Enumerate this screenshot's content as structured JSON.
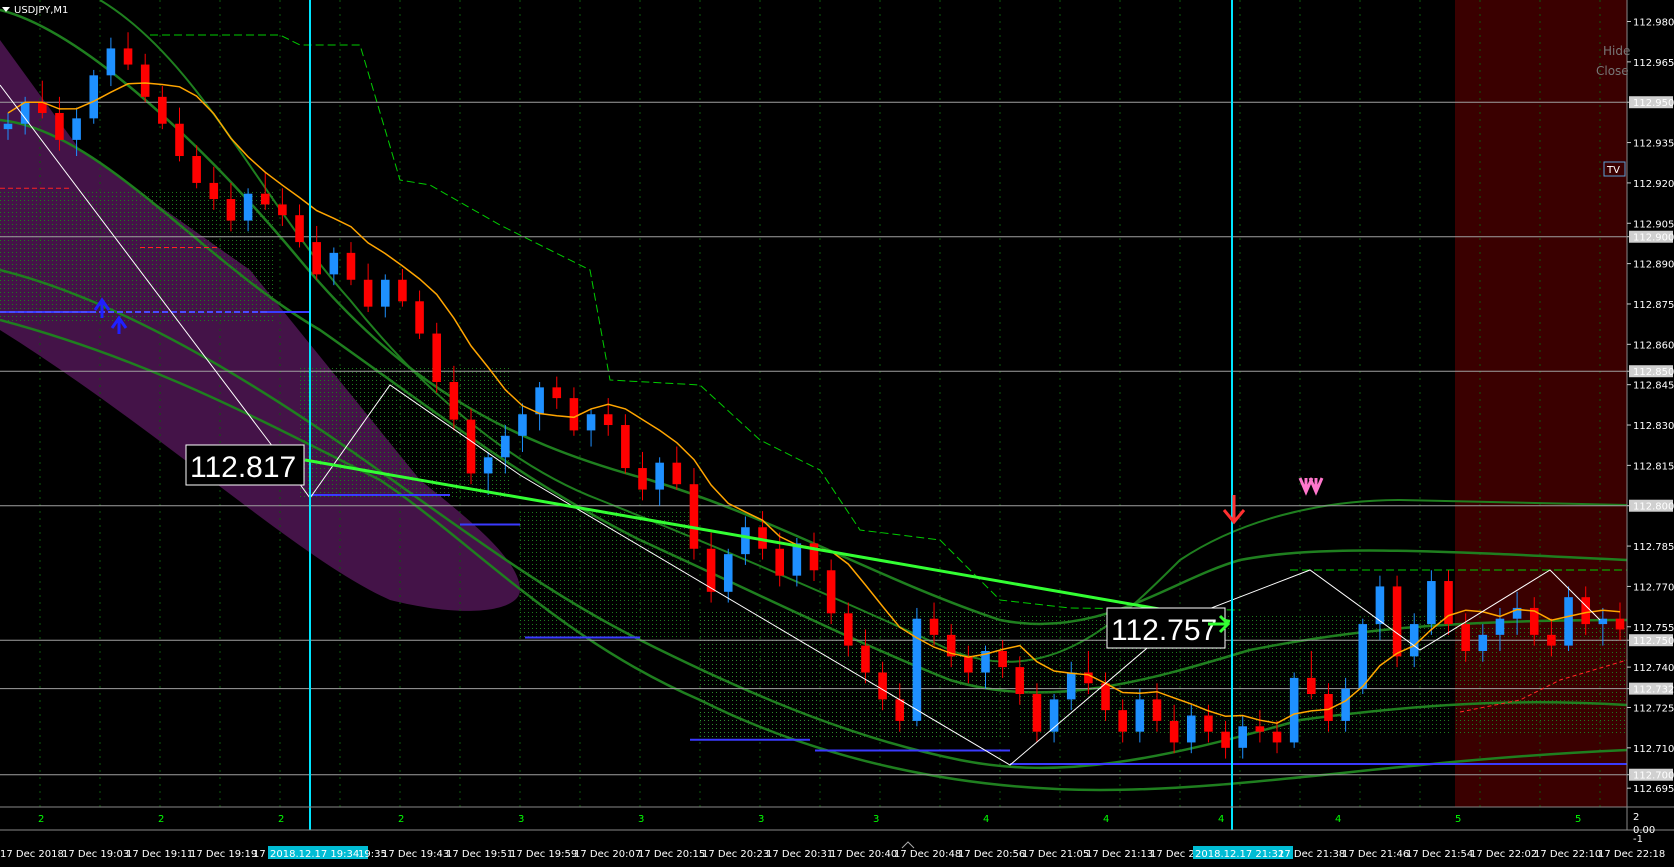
{
  "window": {
    "symbol_title": "USDJPY,M1"
  },
  "side_buttons": {
    "hide": "Hide",
    "close": "Close",
    "tv": "TV"
  },
  "colors": {
    "background": "#000000",
    "bull": "#1e90ff",
    "bear": "#ff0000",
    "axis_text": "#ffffff",
    "vline": "#00e5ff",
    "ma": "#ffa500",
    "bands": "#1f7f1f",
    "dashed": "#00cc00",
    "purple_channel": "#4b1550",
    "dark_red_zone": "#3a0000",
    "green_trend": "#33ff33",
    "support_blue": "#3a3aff",
    "hline": "#a0a0a0"
  },
  "icons": [
    "blue-up-arrow-icon",
    "red-down-arrow-icon",
    "pink-double-down-arrow-icon",
    "green-arrow-icon"
  ],
  "annotations": {
    "label_left": "112.817",
    "label_right": "112.757"
  },
  "chart_data": {
    "type": "candlestick",
    "symbol": "USDJPY",
    "timeframe": "M1",
    "ylim": [
      112.688,
      112.988
    ],
    "price_ticks": [
      "112.980",
      "112.965",
      "112.950",
      "112.935",
      "112.920",
      "112.905",
      "112.900",
      "112.890",
      "112.875",
      "112.860",
      "112.850",
      "112.845",
      "112.830",
      "112.815",
      "112.800",
      "112.785",
      "112.770",
      "112.755",
      "112.750",
      "112.740",
      "112.732",
      "112.725",
      "112.710",
      "112.700",
      "112.695"
    ],
    "highlighted_prices": [
      "112.950",
      "112.900",
      "112.850",
      "112.800",
      "112.750",
      "112.732",
      "112.700"
    ],
    "time_labels": [
      "17 Dec 2018",
      "17 Dec 19:03",
      "17 Dec 19:11",
      "17 Dec 19:19",
      "17 Dec 1",
      "2018.12.17 19:34",
      "19:35",
      "17 Dec 19:43",
      "17 Dec 19:51",
      "17 Dec 19:59",
      "17 Dec 20:07",
      "17 Dec 20:15",
      "17 Dec 20:23",
      "17 Dec 20:31",
      "17 Dec 20:40",
      "17 Dec 20:48",
      "17 Dec 20:56",
      "17 Dec 21:05",
      "17 Dec 21:13",
      "17 Dec 21",
      "2018.12.17 21:32",
      "17 Dec 21:38",
      "17 Dec 21:46",
      "17 Dec 21:54",
      "17 Dec 22:02",
      "17 Dec 22:10",
      "17 Dec 22:18"
    ],
    "time_label_highlight": [
      "2018.12.17 19:34",
      "2018.12.17 21:32"
    ],
    "session_digits": [
      "2",
      "2",
      "2",
      "2",
      "3",
      "3",
      "3",
      "3",
      "4",
      "4",
      "4",
      "4",
      "5",
      "5"
    ],
    "sub_window_ticks": [
      "2",
      "0.00",
      "-1"
    ],
    "horizontal_levels": [
      112.95,
      112.9,
      112.85,
      112.8,
      112.75,
      112.732,
      112.7
    ],
    "support_levels": [
      112.872,
      112.804,
      112.793,
      112.751,
      112.713,
      112.709,
      112.704
    ],
    "trend_label_left": 112.817,
    "trend_label_right": 112.757,
    "candles_ohlc_approx": [
      [
        112.94,
        112.946,
        112.936,
        112.942
      ],
      [
        112.942,
        112.952,
        112.938,
        112.95
      ],
      [
        112.95,
        112.958,
        112.944,
        112.946
      ],
      [
        112.946,
        112.952,
        112.932,
        112.936
      ],
      [
        112.936,
        112.948,
        112.93,
        112.944
      ],
      [
        112.944,
        112.962,
        112.942,
        112.96
      ],
      [
        112.96,
        112.974,
        112.956,
        112.97
      ],
      [
        112.97,
        112.976,
        112.962,
        112.964
      ],
      [
        112.964,
        112.968,
        112.95,
        112.952
      ],
      [
        112.952,
        112.956,
        112.94,
        112.942
      ],
      [
        112.942,
        112.948,
        112.928,
        112.93
      ],
      [
        112.93,
        112.934,
        112.918,
        112.92
      ],
      [
        112.92,
        112.926,
        112.91,
        112.914
      ],
      [
        112.914,
        112.92,
        112.902,
        112.906
      ],
      [
        112.906,
        112.918,
        112.902,
        112.916
      ],
      [
        112.916,
        112.924,
        112.91,
        112.912
      ],
      [
        112.912,
        112.918,
        112.904,
        112.908
      ],
      [
        112.908,
        112.912,
        112.896,
        112.898
      ],
      [
        112.898,
        112.904,
        112.884,
        112.886
      ],
      [
        112.886,
        112.896,
        112.882,
        112.894
      ],
      [
        112.894,
        112.898,
        112.882,
        112.884
      ],
      [
        112.884,
        112.89,
        112.872,
        112.874
      ],
      [
        112.874,
        112.886,
        112.87,
        112.884
      ],
      [
        112.884,
        112.888,
        112.874,
        112.876
      ],
      [
        112.876,
        112.88,
        112.862,
        112.864
      ],
      [
        112.864,
        112.868,
        112.842,
        112.846
      ],
      [
        112.846,
        112.852,
        112.828,
        112.832
      ],
      [
        112.832,
        112.836,
        112.808,
        112.812
      ],
      [
        112.812,
        112.82,
        112.804,
        112.818
      ],
      [
        112.818,
        112.83,
        112.812,
        112.826
      ],
      [
        112.826,
        112.838,
        112.82,
        112.834
      ],
      [
        112.834,
        112.846,
        112.828,
        112.844
      ],
      [
        112.844,
        112.848,
        112.836,
        112.84
      ],
      [
        112.84,
        112.844,
        112.826,
        112.828
      ],
      [
        112.828,
        112.836,
        112.822,
        112.834
      ],
      [
        112.834,
        112.84,
        112.826,
        112.83
      ],
      [
        112.83,
        112.834,
        112.812,
        112.814
      ],
      [
        112.814,
        112.82,
        112.802,
        112.806
      ],
      [
        112.806,
        112.818,
        112.8,
        112.816
      ],
      [
        112.816,
        112.822,
        112.806,
        112.808
      ],
      [
        112.808,
        112.814,
        112.78,
        112.784
      ],
      [
        112.784,
        112.79,
        112.764,
        112.768
      ],
      [
        112.768,
        112.784,
        112.764,
        112.782
      ],
      [
        112.782,
        112.796,
        112.778,
        112.792
      ],
      [
        112.792,
        112.798,
        112.78,
        112.784
      ],
      [
        112.784,
        112.79,
        112.77,
        112.774
      ],
      [
        112.774,
        112.788,
        112.77,
        112.786
      ],
      [
        112.786,
        112.79,
        112.772,
        112.776
      ],
      [
        112.776,
        112.78,
        112.756,
        112.76
      ],
      [
        112.76,
        112.764,
        112.744,
        112.748
      ],
      [
        112.748,
        112.754,
        112.734,
        112.738
      ],
      [
        112.738,
        112.742,
        112.724,
        112.728
      ],
      [
        112.728,
        112.734,
        112.716,
        112.72
      ],
      [
        112.72,
        112.762,
        112.718,
        112.758
      ],
      [
        112.758,
        112.764,
        112.748,
        112.752
      ],
      [
        112.752,
        112.756,
        112.74,
        112.744
      ],
      [
        112.744,
        112.748,
        112.734,
        112.738
      ],
      [
        112.738,
        112.748,
        112.732,
        112.746
      ],
      [
        112.746,
        112.75,
        112.736,
        112.74
      ],
      [
        112.74,
        112.744,
        112.726,
        112.73
      ],
      [
        112.73,
        112.734,
        112.712,
        112.716
      ],
      [
        112.716,
        112.73,
        112.712,
        112.728
      ],
      [
        112.728,
        112.742,
        112.724,
        112.738
      ],
      [
        112.738,
        112.746,
        112.73,
        112.734
      ],
      [
        112.734,
        112.738,
        112.72,
        112.724
      ],
      [
        112.724,
        112.728,
        112.712,
        112.716
      ],
      [
        112.716,
        112.732,
        112.712,
        112.728
      ],
      [
        112.728,
        112.734,
        112.716,
        112.72
      ],
      [
        112.72,
        112.726,
        112.708,
        112.712
      ],
      [
        112.712,
        112.726,
        112.708,
        112.722
      ],
      [
        112.722,
        112.726,
        112.712,
        112.716
      ],
      [
        112.716,
        112.72,
        112.706,
        112.71
      ],
      [
        112.71,
        112.722,
        112.706,
        112.718
      ],
      [
        112.718,
        112.724,
        112.712,
        112.716
      ],
      [
        112.716,
        112.72,
        112.708,
        112.712
      ],
      [
        112.712,
        112.738,
        112.71,
        112.736
      ],
      [
        112.736,
        112.746,
        112.728,
        112.73
      ],
      [
        112.73,
        112.734,
        112.716,
        112.72
      ],
      [
        112.72,
        112.736,
        112.716,
        112.732
      ],
      [
        112.732,
        112.758,
        112.73,
        112.756
      ],
      [
        112.756,
        112.774,
        112.75,
        112.77
      ],
      [
        112.77,
        112.774,
        112.74,
        112.744
      ],
      [
        112.744,
        112.76,
        112.74,
        112.756
      ],
      [
        112.756,
        112.776,
        112.752,
        112.772
      ],
      [
        112.772,
        112.776,
        112.752,
        112.756
      ],
      [
        112.756,
        112.76,
        112.742,
        112.746
      ],
      [
        112.746,
        112.756,
        112.742,
        112.752
      ],
      [
        112.752,
        112.762,
        112.746,
        112.758
      ],
      [
        112.758,
        112.768,
        112.752,
        112.762
      ],
      [
        112.762,
        112.766,
        112.748,
        112.752
      ],
      [
        112.752,
        112.758,
        112.744,
        112.748
      ],
      [
        112.748,
        112.77,
        112.746,
        112.766
      ],
      [
        112.766,
        112.77,
        112.752,
        112.756
      ],
      [
        112.756,
        112.762,
        112.748,
        112.758
      ],
      [
        112.758,
        112.764,
        112.75,
        112.754
      ]
    ]
  }
}
